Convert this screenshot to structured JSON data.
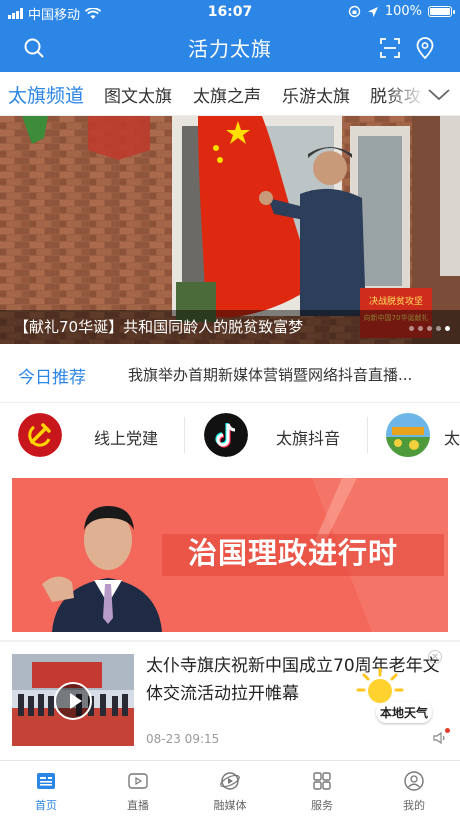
{
  "status_bar": {
    "carrier": "中国移动",
    "time": "16:07",
    "battery_text": "100%",
    "battery_level": 1.0
  },
  "header": {
    "title": "活力太旗",
    "icons": [
      "search-icon",
      "scan-icon",
      "location-icon"
    ],
    "bg_color": "#2b86e6"
  },
  "tabs": {
    "items": [
      {
        "label": "太旗频道",
        "active": true
      },
      {
        "label": "图文太旗",
        "active": false
      },
      {
        "label": "太旗之声",
        "active": false
      },
      {
        "label": "乐游太旗",
        "active": false
      },
      {
        "label": "脱贫攻",
        "active": false
      }
    ],
    "more_icon": "chevron-down-icon"
  },
  "banner": {
    "caption": "【献礼70华诞】共和国同龄人的脱贫致富梦",
    "sign_text": "决战脱贫攻坚",
    "sign_subtext": "向新中国70华诞献礼",
    "slide_index": 4,
    "slide_count": 5
  },
  "recommend": {
    "label": "今日推荐",
    "headline": "我旗举办首期新媒体营销暨网络抖音直播..."
  },
  "quick_links": [
    {
      "label": "线上党建",
      "icon": "party-emblem-icon"
    },
    {
      "label": "太旗抖音",
      "icon": "tiktok-icon"
    },
    {
      "label": "太",
      "icon": "scenery-thumbnail"
    }
  ],
  "ad": {
    "text": "治国理政进行时"
  },
  "news": {
    "title": "太仆寺旗庆祝新中国成立70周年老年文体交流活动拉开帷幕",
    "time": "08-23 09:15",
    "has_video": true
  },
  "weather_widget": {
    "label": "本地天气",
    "close_icon": "close-icon"
  },
  "bottom_nav": [
    {
      "label": "首页",
      "icon": "home-news-icon",
      "active": true
    },
    {
      "label": "直播",
      "icon": "live-play-icon",
      "active": false
    },
    {
      "label": "融媒体",
      "icon": "media-globe-icon",
      "active": false
    },
    {
      "label": "服务",
      "icon": "grid-services-icon",
      "active": false
    },
    {
      "label": "我的",
      "icon": "profile-icon",
      "active": false
    }
  ],
  "colors": {
    "accent": "#2b86e6",
    "ad_background": "#f3685a"
  }
}
